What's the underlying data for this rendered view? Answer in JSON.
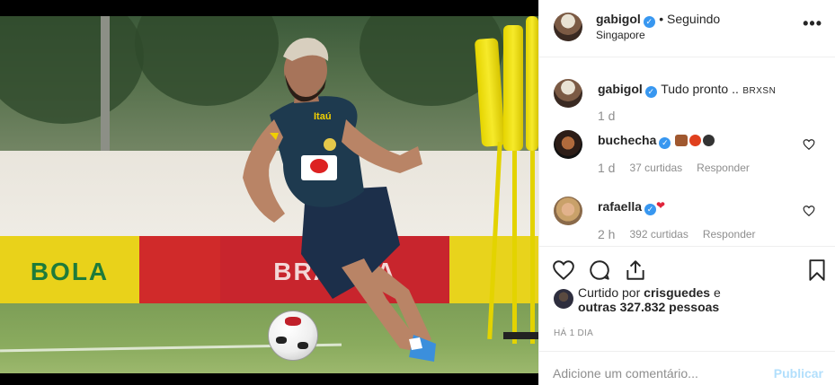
{
  "post": {
    "author": "gabigol",
    "follow_status": "• Seguindo",
    "location": "Singapore"
  },
  "caption": {
    "author": "gabigol",
    "text": "Tudo pronto ..",
    "tag": "BRXSN",
    "time": "1 d"
  },
  "comments": [
    {
      "author": "buchecha",
      "time": "1 d",
      "likes": "37 curtidas",
      "reply": "Responder"
    },
    {
      "author": "rafaella",
      "time": "2 h",
      "likes": "392 curtidas",
      "reply": "Responder"
    }
  ],
  "likes": {
    "prefix": "Curtido por",
    "user": "crisguedes",
    "suffix": "e",
    "others": "outras 327.832 pessoas"
  },
  "posted_ago": "HÁ 1 DIA",
  "add_comment": {
    "placeholder": "Adicione um comentário...",
    "publish": "Publicar"
  },
  "photo": {
    "jersey_badge": "Itaú",
    "banner_left": "BOLA",
    "banner_mid": "BRAHMA"
  },
  "colors": {
    "verified": "#3897f0",
    "publish_disabled": "#b2dffc",
    "muted": "#8e8e8e"
  }
}
